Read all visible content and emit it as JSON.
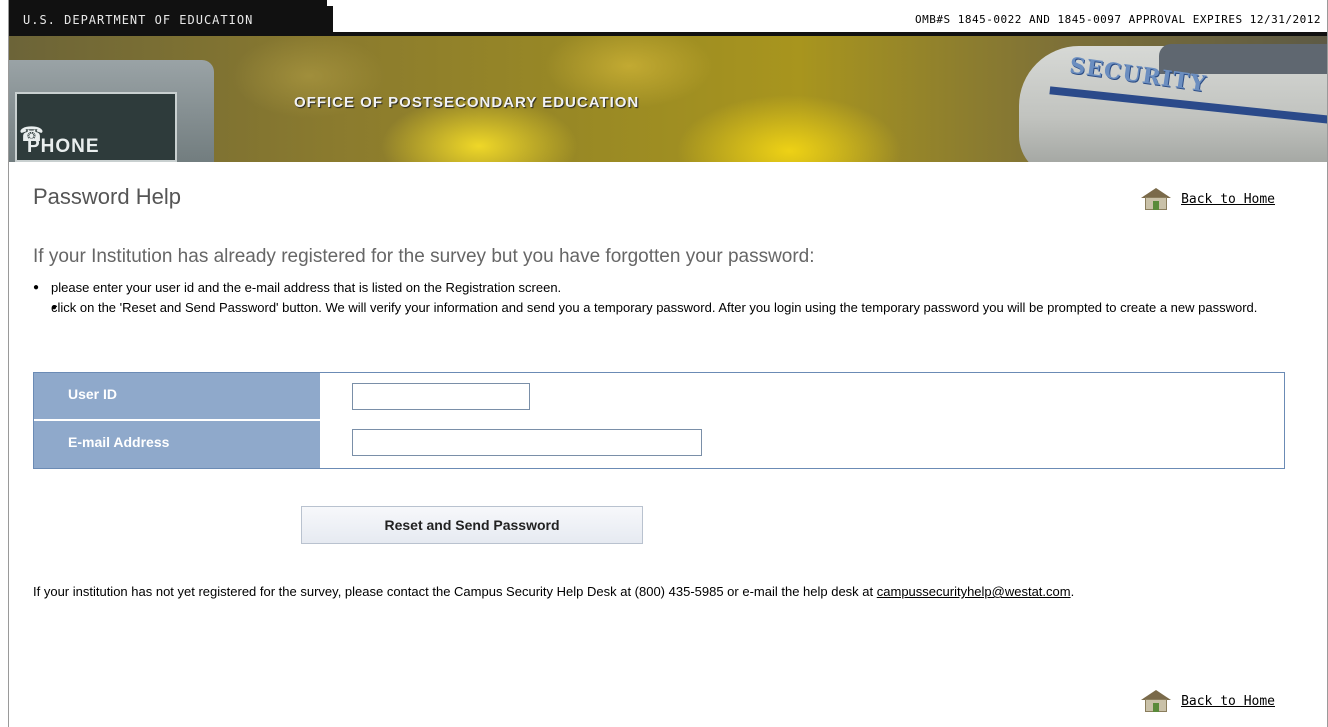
{
  "topbar": {
    "department": "U.S. DEPARTMENT OF EDUCATION",
    "omb": "OMB#S 1845-0022 AND 1845-0097 APPROVAL EXPIRES 12/31/2012"
  },
  "banner": {
    "office": "OFFICE OF POSTSECONDARY EDUCATION",
    "phone_label": "PHONE",
    "security_label": "SECURITY"
  },
  "page": {
    "title": "Password Help",
    "back_home": "Back to Home",
    "intro": "If your Institution has already registered for the survey but you have forgotten your password:",
    "bullets": [
      "please enter your user id and the e-mail address that is listed on the Registration screen.",
      "click on the 'Reset and Send Password' button. We will verify your information and send you a temporary password. After you login using the temporary password you will be prompted to create a new password."
    ]
  },
  "form": {
    "user_id_label": "User ID",
    "user_id_value": "",
    "email_label": "E-mail Address",
    "email_value": "",
    "submit_label": "Reset and Send Password"
  },
  "footer": {
    "note": "If your institution has not yet registered for the survey, please contact the Campus Security Help Desk at (800) 435-5985 or e-mail the help desk at",
    "email_link": "campussecurityhelp@westat.com",
    "trailing": "."
  },
  "icons": {
    "home": "home-icon"
  },
  "colors": {
    "label_bg": "#8fa9cb",
    "table_border": "#6b8bb5",
    "header_black": "#111111"
  }
}
